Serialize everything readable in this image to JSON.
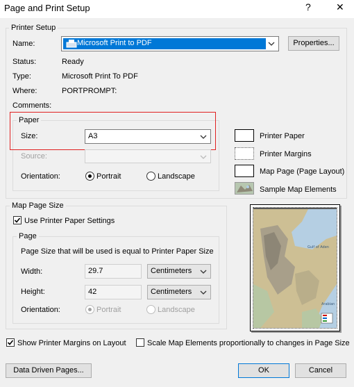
{
  "window": {
    "title": "Page and Print Setup",
    "help_glyph": "?",
    "close_glyph": "✕"
  },
  "printer_setup": {
    "legend": "Printer Setup",
    "name_label": "Name:",
    "name_value": "Microsoft Print to PDF",
    "properties_label": "Properties...",
    "status_label": "Status:",
    "status_value": "Ready",
    "type_label": "Type:",
    "type_value": "Microsoft Print To PDF",
    "where_label": "Where:",
    "where_value": "PORTPROMPT:",
    "comments_label": "Comments:"
  },
  "paper": {
    "legend": "Paper",
    "size_label": "Size:",
    "size_value": "A3",
    "source_label": "Source:",
    "source_value": "",
    "orientation_label": "Orientation:",
    "portrait_label": "Portrait",
    "landscape_label": "Landscape",
    "selected_orientation": "Portrait"
  },
  "legend_panel": {
    "printer_paper": "Printer Paper",
    "printer_margins": "Printer Margins",
    "map_page": "Map Page (Page Layout)",
    "sample_elements": "Sample Map Elements"
  },
  "map_page_size": {
    "legend": "Map Page Size",
    "use_printer_settings_label": "Use Printer Paper Settings",
    "use_printer_settings_checked": true,
    "page_legend": "Page",
    "info_text": "Page Size that will be used is equal to Printer Paper Size",
    "width_label": "Width:",
    "width_value": "29.7",
    "width_unit": "Centimeters",
    "height_label": "Height:",
    "height_value": "42",
    "height_unit": "Centimeters",
    "orientation_label": "Orientation:",
    "portrait_label": "Portrait",
    "landscape_label": "Landscape",
    "selected_orientation": "Portrait"
  },
  "options": {
    "show_margins_label": "Show Printer Margins on Layout",
    "show_margins_checked": true,
    "scale_elements_label": "Scale Map Elements proportionally to changes in Page Size",
    "scale_elements_checked": false
  },
  "buttons": {
    "data_driven": "Data Driven Pages...",
    "ok": "OK",
    "cancel": "Cancel"
  },
  "map_preview_labels": {
    "gulf": "Gulf of Aden",
    "sea": "Arabian"
  },
  "colors": {
    "highlight": "#0078d7",
    "red_box": "#e02020",
    "accent_blue": "#0078d7"
  }
}
